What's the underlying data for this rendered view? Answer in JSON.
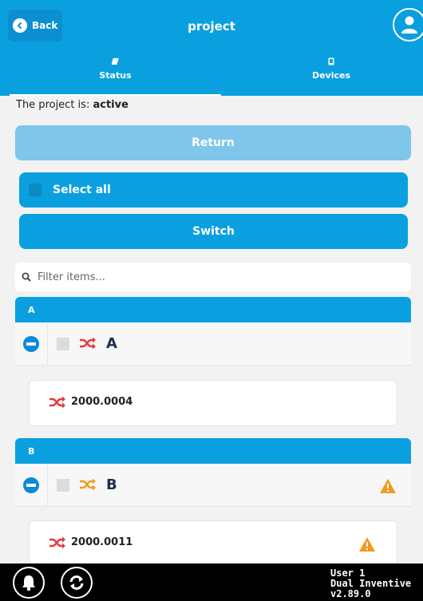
{
  "header": {
    "back_label": "Back",
    "title": "project",
    "tabs": [
      {
        "label": "Status",
        "active": true
      },
      {
        "label": "Devices",
        "active": false
      }
    ]
  },
  "status": {
    "prefix": "The project is:",
    "value": "active"
  },
  "actions": {
    "return_label": "Return",
    "select_all_label": "Select all",
    "switch_label": "Switch"
  },
  "filter": {
    "placeholder": "Filter items..."
  },
  "groups": [
    {
      "header": "A",
      "name": "A",
      "warning": false,
      "item": {
        "name": "2000.0004",
        "warning": false
      }
    },
    {
      "header": "B",
      "name": "B",
      "warning": true,
      "item": {
        "name": "2000.0011",
        "warning": true
      }
    }
  ],
  "footer": {
    "user_line1": "User 1",
    "user_line2": "Dual Inventive",
    "version": "v2.89.0"
  },
  "colors": {
    "primary": "#0aa0e0",
    "disabled": "#7fc6ea",
    "shuffle_red": "#e8383d",
    "shuffle_orange": "#f29a1f",
    "warning": "#f29a1f"
  },
  "icons": {
    "back": "chevron-left-icon",
    "user": "user-icon",
    "status": "tag-icon",
    "devices": "device-icon",
    "search": "search-icon",
    "shuffle": "shuffle-icon",
    "warning": "warning-icon",
    "bell": "bell-icon",
    "sync": "sync-icon"
  }
}
